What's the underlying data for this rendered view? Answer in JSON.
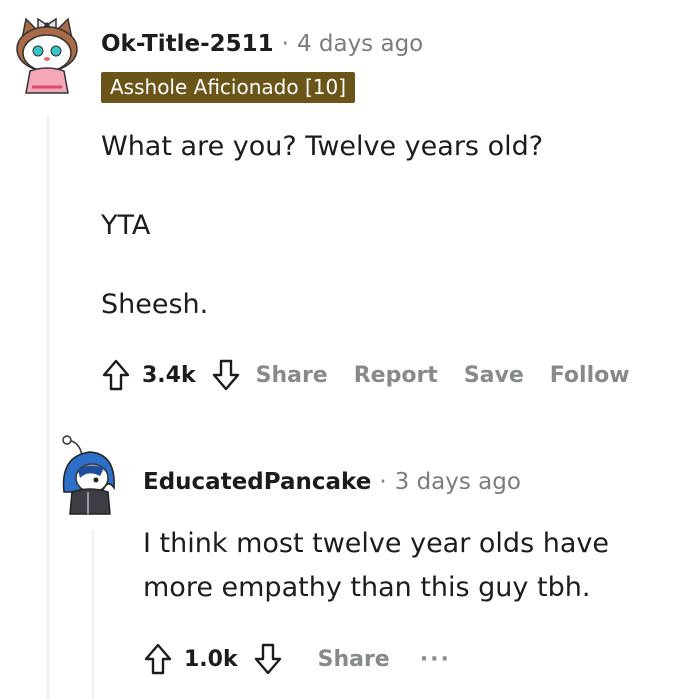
{
  "comment": {
    "username": "Ok-Title-2511",
    "separator": "·",
    "timestamp": "4 days ago",
    "flair": "Asshole Aficionado [10]",
    "paragraphs": [
      "What are you? Twelve years old?",
      "YTA",
      "Sheesh."
    ],
    "vote_count": "3.4k",
    "actions": {
      "share": "Share",
      "report": "Report",
      "save": "Save",
      "follow": "Follow"
    }
  },
  "reply": {
    "username": "EducatedPancake",
    "separator": "·",
    "timestamp": "3 days ago",
    "lines": [
      "I think most twelve year olds have",
      "more empathy than this guy tbh."
    ],
    "vote_count": "1.0k",
    "actions": {
      "share": "Share",
      "more": "···"
    }
  },
  "colors": {
    "flair_background": "#6b5418",
    "thread_line": "#edeff1",
    "muted_text": "#7c7c7c",
    "action_text": "#878a8c"
  },
  "icons": {
    "upvote": "upvote-arrow-icon",
    "downvote": "downvote-arrow-icon",
    "more": "more-options-icon"
  }
}
